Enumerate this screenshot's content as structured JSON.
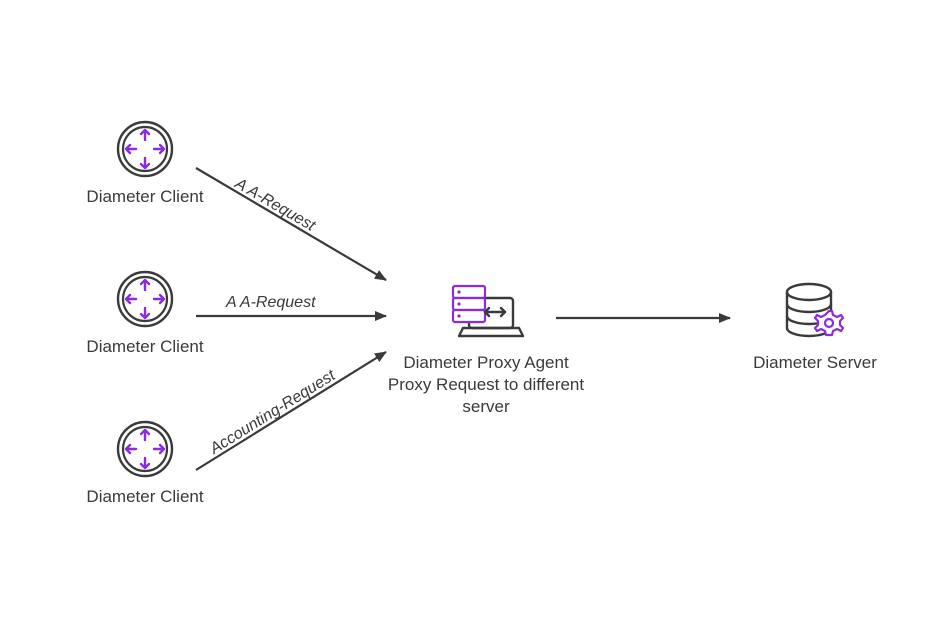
{
  "nodes": {
    "client1": {
      "label": "Diameter Client"
    },
    "client2": {
      "label": "Diameter Client"
    },
    "client3": {
      "label": "Diameter Client"
    },
    "proxy": {
      "label": "Diameter Proxy Agent\nProxy Request to different\nserver"
    },
    "server": {
      "label": "Diameter Server"
    }
  },
  "edges": {
    "c1_proxy": {
      "label": "A A-Request"
    },
    "c2_proxy": {
      "label": "A A-Request"
    },
    "c3_proxy": {
      "label": "Accounting-Request"
    },
    "proxy_server": {
      "label": ""
    }
  },
  "colors": {
    "stroke": "#3a3a3a",
    "accent": "#8a2be2"
  }
}
